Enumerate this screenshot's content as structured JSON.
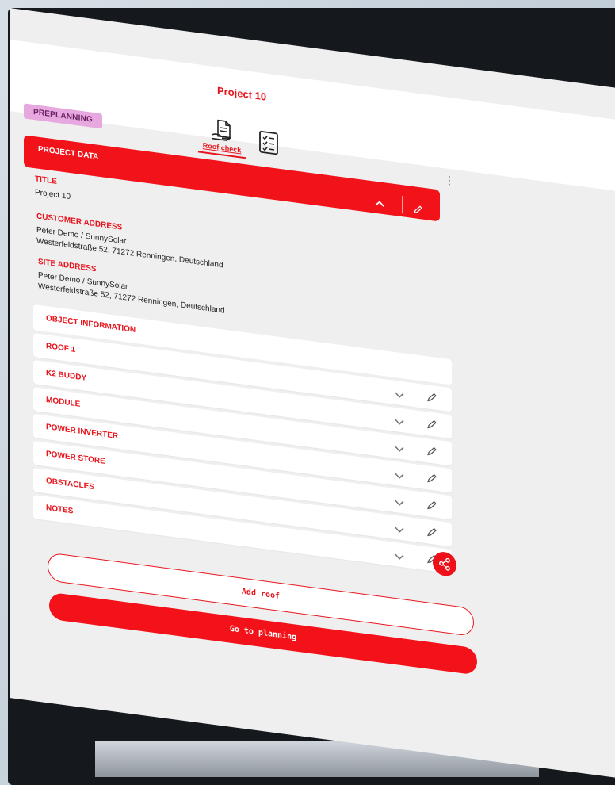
{
  "header": {
    "title": "Project 10",
    "status_badge": "PREPLANNING",
    "roof_check_label": "Roof check"
  },
  "project_data": {
    "section_label": "PROJECT DATA",
    "title_label": "TITLE",
    "title_value": "Project 10",
    "customer_address_label": "CUSTOMER ADDRESS",
    "customer_name": "Peter Demo / SunnySolar",
    "customer_street": "Westerfeldstraße 52, 71272 Renningen, Deutschland",
    "site_address_label": "SITE ADDRESS",
    "site_name": "Peter Demo / SunnySolar",
    "site_street": "Westerfeldstraße 52, 71272 Renningen, Deutschland"
  },
  "object_information": {
    "label": "OBJECT INFORMATION",
    "items": [
      {
        "label": "ROOF 1"
      },
      {
        "label": "K2 BUDDY"
      },
      {
        "label": "MODULE"
      },
      {
        "label": "POWER INVERTER"
      },
      {
        "label": "POWER STORE"
      },
      {
        "label": "OBSTACLES"
      },
      {
        "label": "NOTES"
      }
    ]
  },
  "actions": {
    "add_roof": "Add roof",
    "go_to_planning": "Go to planning"
  },
  "colors": {
    "accent": "#e8141c",
    "badge_bg": "#e6a8de",
    "screen_bg": "#efefef"
  },
  "icons": {
    "roof_check": "roof-document-icon",
    "checklist": "checklist-icon",
    "menu": "kebab-menu-icon",
    "collapse": "chevron-up-icon",
    "expand": "chevron-down-icon",
    "edit": "pencil-icon",
    "share": "share-icon"
  }
}
